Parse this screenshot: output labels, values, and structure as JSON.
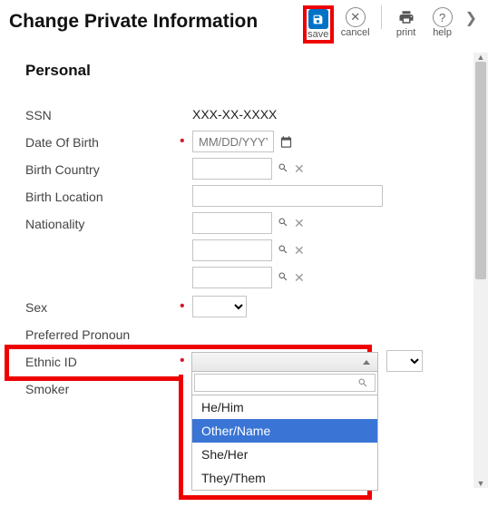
{
  "header": {
    "title": "Change Private Information",
    "save_label": "save",
    "cancel_label": "cancel",
    "print_label": "print",
    "help_label": "help"
  },
  "section": {
    "title": "Personal"
  },
  "fields": {
    "ssn_label": "SSN",
    "ssn_value": "XXX-XX-XXXX",
    "dob_label": "Date Of Birth",
    "dob_placeholder": "MM/DD/YYYY",
    "birth_country_label": "Birth Country",
    "birth_location_label": "Birth Location",
    "nationality_label": "Nationality",
    "sex_label": "Sex",
    "pronoun_label": "Preferred Pronoun",
    "ethnic_label": "Ethnic ID",
    "smoker_label": "Smoker"
  },
  "pronoun_dropdown": {
    "search": "",
    "options": [
      "He/Him",
      "Other/Name",
      "She/Her",
      "They/Them"
    ],
    "selected": "Other/Name"
  },
  "colors": {
    "accent": "#0072c6",
    "highlight": "#e00",
    "selection": "#3a75d6"
  }
}
